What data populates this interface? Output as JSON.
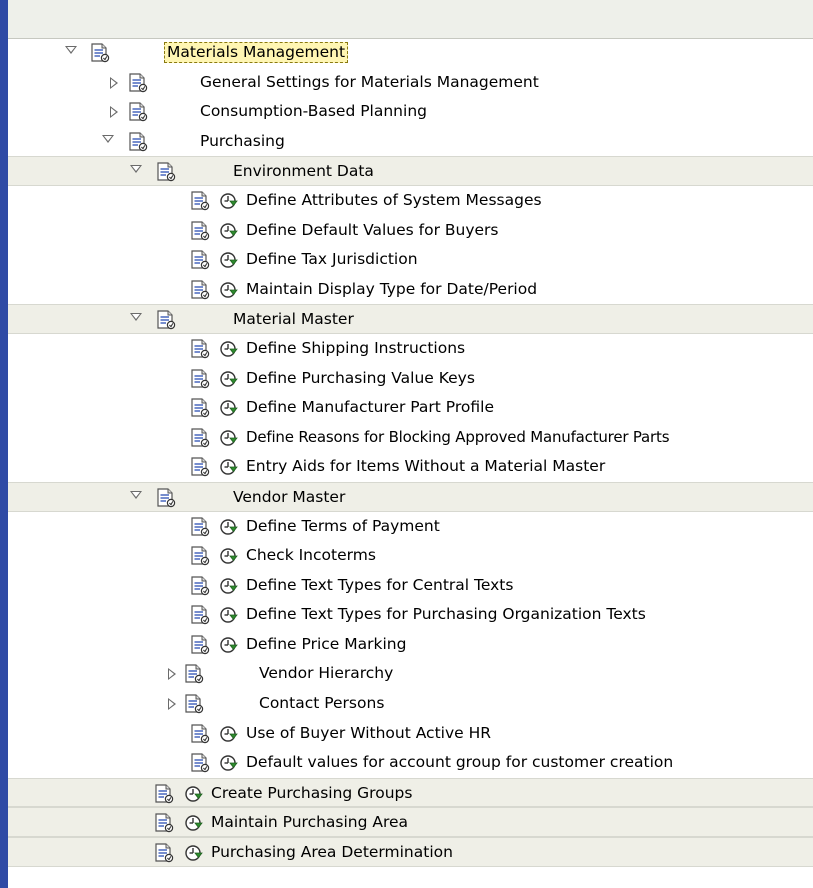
{
  "tree": {
    "root": {
      "label": "Materials Management"
    },
    "general_settings": {
      "label": "General Settings for Materials Management"
    },
    "consumption_planning": {
      "label": "Consumption-Based Planning"
    },
    "purchasing": {
      "label": "Purchasing"
    },
    "environment_data": {
      "label": "Environment Data",
      "items": [
        "Define Attributes of System Messages",
        "Define Default Values for Buyers",
        "Define Tax Jurisdiction",
        "Maintain Display Type for Date/Period"
      ]
    },
    "material_master": {
      "label": "Material Master",
      "items": [
        "Define Shipping Instructions",
        "Define Purchasing Value Keys",
        "Define Manufacturer Part Profile",
        "Define Reasons for Blocking Approved Manufacturer Parts",
        "Entry Aids for Items Without a Material Master"
      ]
    },
    "vendor_master": {
      "label": "Vendor Master",
      "items_a": [
        "Define Terms of Payment",
        "Check Incoterms",
        "Define Text Types for Central Texts",
        "Define Text Types for Purchasing Organization Texts",
        "Define Price Marking"
      ],
      "vendor_hierarchy": "Vendor Hierarchy",
      "contact_persons": "Contact Persons",
      "items_b": [
        "Use of Buyer Without Active HR",
        "Default values for account group for customer creation"
      ]
    },
    "purchasing_items": [
      "Create Purchasing Groups",
      "Maintain Purchasing Area",
      "Purchasing Area Determination"
    ]
  },
  "colors": {
    "window_border": "#2f4aa5",
    "header_band": "#eef0ea",
    "row_shade": "#efefe7",
    "selection": "#fff6b3",
    "execute_icon_green": "#2e8b2e"
  },
  "icons": {
    "node_doc": "documentation-icon",
    "execute": "execute-clock-icon",
    "expanded": "triangle-down-icon",
    "collapsed": "triangle-right-icon"
  }
}
